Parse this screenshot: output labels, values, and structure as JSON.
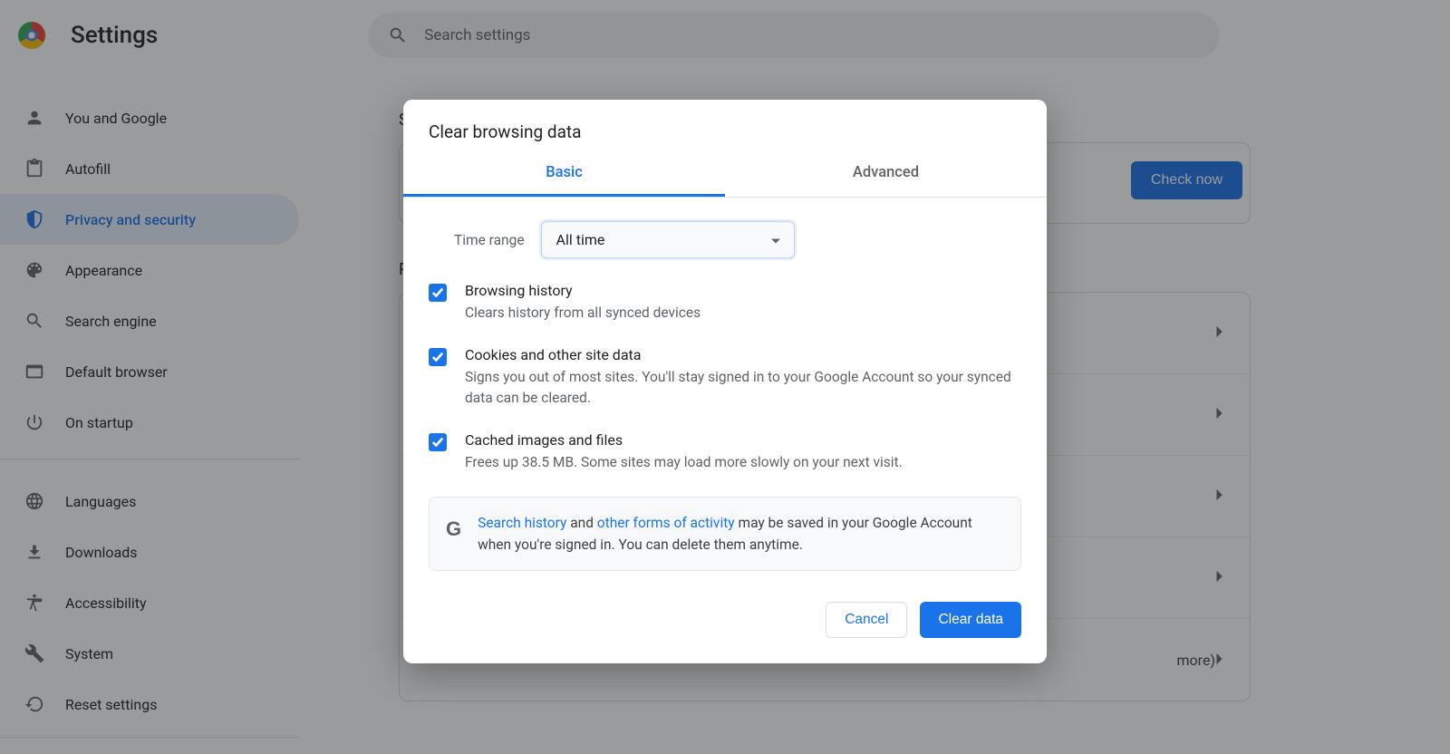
{
  "header": {
    "title": "Settings",
    "search_placeholder": "Search settings"
  },
  "sidebar": {
    "items": [
      {
        "label": "You and Google",
        "icon": "person-icon"
      },
      {
        "label": "Autofill",
        "icon": "clipboard-icon"
      },
      {
        "label": "Privacy and security",
        "icon": "shield-icon",
        "active": true
      },
      {
        "label": "Appearance",
        "icon": "palette-icon"
      },
      {
        "label": "Search engine",
        "icon": "search-icon"
      },
      {
        "label": "Default browser",
        "icon": "browser-icon"
      },
      {
        "label": "On startup",
        "icon": "power-icon"
      }
    ],
    "secondary": [
      {
        "label": "Languages",
        "icon": "globe-icon"
      },
      {
        "label": "Downloads",
        "icon": "download-icon"
      },
      {
        "label": "Accessibility",
        "icon": "accessibility-icon"
      },
      {
        "label": "System",
        "icon": "wrench-icon"
      },
      {
        "label": "Reset settings",
        "icon": "reset-icon"
      }
    ]
  },
  "main": {
    "safety_section": "Saf",
    "check_now": "Check now",
    "privacy_section": "Pri",
    "more_suffix": "more)"
  },
  "dialog": {
    "title": "Clear browsing data",
    "tabs": {
      "basic": "Basic",
      "advanced": "Advanced"
    },
    "time_range_label": "Time range",
    "time_range_value": "All time",
    "items": [
      {
        "title": "Browsing history",
        "desc": "Clears history from all synced devices",
        "checked": true
      },
      {
        "title": "Cookies and other site data",
        "desc": "Signs you out of most sites. You'll stay signed in to your Google Account so your synced data can be cleared.",
        "checked": true
      },
      {
        "title": "Cached images and files",
        "desc": "Frees up 38.5 MB. Some sites may load more slowly on your next visit.",
        "checked": true
      }
    ],
    "notice": {
      "search_history_link": "Search history",
      "t1": " and ",
      "other_forms_link": "other forms of activity",
      "t2": " may be saved in your Google Account when you're signed in. You can delete them anytime."
    },
    "actions": {
      "cancel": "Cancel",
      "clear": "Clear data"
    }
  },
  "colors": {
    "accent": "#1a73e8"
  }
}
